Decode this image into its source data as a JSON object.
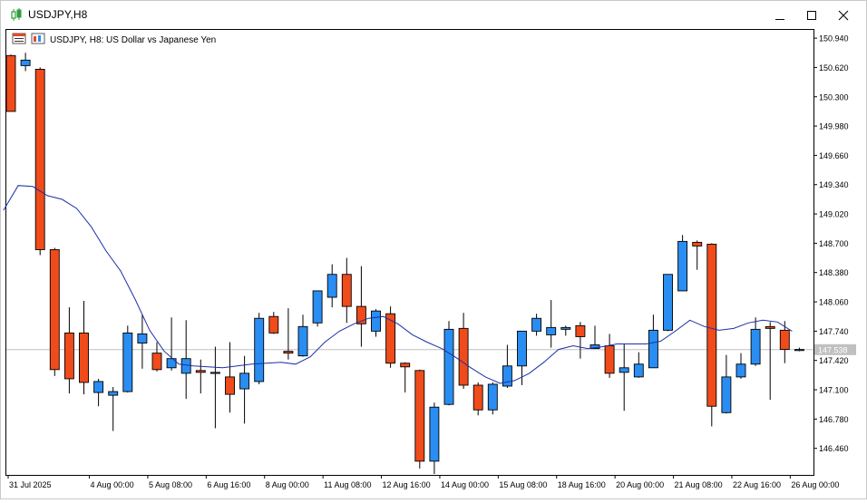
{
  "window": {
    "title": "USDJPY,H8",
    "icons": {
      "app": "chart-candles-icon",
      "minimize": "minimize-icon",
      "maximize": "maximize-icon",
      "close": "close-icon"
    }
  },
  "chart_header": {
    "text": "USDJPY, H8:  US Dollar vs Japanese Yen",
    "icons": [
      "chart-window-icon",
      "chart-type-icon"
    ]
  },
  "colors": {
    "bull": "#2a8df2",
    "bear": "#ef4b1b",
    "ma": "#1c2fa6",
    "price_line": "#c0c0c0",
    "price_tag_bg": "#c0c0c0"
  },
  "current_price": {
    "label": "147.538",
    "value": 147.538
  },
  "chart_data": {
    "type": "candlestick",
    "symbol": "USDJPY",
    "timeframe": "H8",
    "title": "USDJPY, H8:  US Dollar vs Japanese Yen",
    "ylim": [
      146.17,
      151.03
    ],
    "y_ticks": [
      "150.940",
      "150.620",
      "150.300",
      "149.980",
      "149.660",
      "149.340",
      "149.020",
      "148.700",
      "148.380",
      "148.060",
      "147.740",
      "147.420",
      "147.100",
      "146.780",
      "146.460"
    ],
    "x_ticks": [
      {
        "label": "31 Jul 2025",
        "index": 0
      },
      {
        "label": "4 Aug 00:00",
        "index": 5.5
      },
      {
        "label": "5 Aug 08:00",
        "index": 9.5
      },
      {
        "label": "6 Aug 16:00",
        "index": 13.5
      },
      {
        "label": "8 Aug 00:00",
        "index": 17.5
      },
      {
        "label": "11 Aug 08:00",
        "index": 21.5
      },
      {
        "label": "12 Aug 16:00",
        "index": 25.5
      },
      {
        "label": "14 Aug 00:00",
        "index": 29.5
      },
      {
        "label": "15 Aug 08:00",
        "index": 33.5
      },
      {
        "label": "18 Aug 16:00",
        "index": 37.5
      },
      {
        "label": "20 Aug 00:00",
        "index": 41.5
      },
      {
        "label": "21 Aug 08:00",
        "index": 45.5
      },
      {
        "label": "22 Aug 16:00",
        "index": 49.5
      },
      {
        "label": "26 Aug 00:00",
        "index": 53.5
      }
    ],
    "candles": [
      [
        150.75,
        150.76,
        150.14,
        150.14
      ],
      [
        150.64,
        150.78,
        150.58,
        150.7
      ],
      [
        150.6,
        150.62,
        148.57,
        148.63
      ],
      [
        148.63,
        148.65,
        147.25,
        147.32
      ],
      [
        147.72,
        148.0,
        147.06,
        147.22
      ],
      [
        147.72,
        148.07,
        147.05,
        147.18
      ],
      [
        147.07,
        147.22,
        146.92,
        147.19
      ],
      [
        147.04,
        147.13,
        146.65,
        147.08
      ],
      [
        147.08,
        147.8,
        147.07,
        147.72
      ],
      [
        147.61,
        147.92,
        147.33,
        147.71
      ],
      [
        147.5,
        147.62,
        147.3,
        147.32
      ],
      [
        147.34,
        147.89,
        147.31,
        147.44
      ],
      [
        147.28,
        147.86,
        147.0,
        147.44
      ],
      [
        147.31,
        147.43,
        147.06,
        147.29
      ],
      [
        147.28,
        147.57,
        146.68,
        147.29
      ],
      [
        147.24,
        147.62,
        146.85,
        147.05
      ],
      [
        147.11,
        147.47,
        146.73,
        147.28
      ],
      [
        147.19,
        147.94,
        147.16,
        147.88
      ],
      [
        147.9,
        147.95,
        147.71,
        147.72
      ],
      [
        147.52,
        147.99,
        147.43,
        147.5
      ],
      [
        147.47,
        147.92,
        147.46,
        147.79
      ],
      [
        147.83,
        148.16,
        147.79,
        148.18
      ],
      [
        148.11,
        148.47,
        148.0,
        148.36
      ],
      [
        148.36,
        148.54,
        147.83,
        148.01
      ],
      [
        148.01,
        148.45,
        147.57,
        147.82
      ],
      [
        147.74,
        147.98,
        147.68,
        147.96
      ],
      [
        147.93,
        148.01,
        147.34,
        147.39
      ],
      [
        147.39,
        147.4,
        147.07,
        147.35
      ],
      [
        147.31,
        147.32,
        146.24,
        146.32
      ],
      [
        146.32,
        146.96,
        146.18,
        146.91
      ],
      [
        146.94,
        147.85,
        146.93,
        147.76
      ],
      [
        147.77,
        147.94,
        147.11,
        147.15
      ],
      [
        147.15,
        147.18,
        146.82,
        146.88
      ],
      [
        146.88,
        147.18,
        146.83,
        147.16
      ],
      [
        147.14,
        147.59,
        147.12,
        147.36
      ],
      [
        147.36,
        147.74,
        147.15,
        147.74
      ],
      [
        147.74,
        147.93,
        147.69,
        147.88
      ],
      [
        147.7,
        148.08,
        147.56,
        147.78
      ],
      [
        147.76,
        147.8,
        147.69,
        147.78
      ],
      [
        147.8,
        147.84,
        147.44,
        147.68
      ],
      [
        147.55,
        147.8,
        147.55,
        147.59
      ],
      [
        147.58,
        147.71,
        147.23,
        147.28
      ],
      [
        147.29,
        147.6,
        146.87,
        147.34
      ],
      [
        147.24,
        147.51,
        147.23,
        147.38
      ],
      [
        147.34,
        147.92,
        147.34,
        147.75
      ],
      [
        147.75,
        148.33,
        147.74,
        148.36
      ],
      [
        148.18,
        148.79,
        148.18,
        148.72
      ],
      [
        148.71,
        148.73,
        148.41,
        148.67
      ],
      [
        148.69,
        148.7,
        146.7,
        146.92
      ],
      [
        146.85,
        147.48,
        146.84,
        147.24
      ],
      [
        147.24,
        147.5,
        147.22,
        147.38
      ],
      [
        147.38,
        147.89,
        147.36,
        147.76
      ],
      [
        147.79,
        147.84,
        146.99,
        147.77
      ],
      [
        147.75,
        147.85,
        147.39,
        147.54
      ],
      [
        147.53,
        147.56,
        147.52,
        147.54
      ]
    ],
    "ma_line": [
      [
        -0.5,
        149.06
      ],
      [
        0.5,
        149.33
      ],
      [
        1.5,
        149.32
      ],
      [
        2.5,
        149.22
      ],
      [
        3.5,
        149.18
      ],
      [
        4.5,
        149.08
      ],
      [
        5.5,
        148.88
      ],
      [
        6.5,
        148.62
      ],
      [
        7.5,
        148.4
      ],
      [
        8.5,
        148.09
      ],
      [
        9.5,
        147.75
      ],
      [
        10.5,
        147.52
      ],
      [
        11.5,
        147.38
      ],
      [
        12.5,
        147.36
      ],
      [
        13.5,
        147.35
      ],
      [
        14.5,
        147.34
      ],
      [
        15.5,
        147.36
      ],
      [
        16.5,
        147.38
      ],
      [
        17.5,
        147.39
      ],
      [
        18.5,
        147.4
      ],
      [
        19.5,
        147.38
      ],
      [
        20.5,
        147.46
      ],
      [
        21.5,
        147.62
      ],
      [
        22.5,
        147.74
      ],
      [
        23.5,
        147.82
      ],
      [
        24.5,
        147.88
      ],
      [
        25.5,
        147.9
      ],
      [
        26.5,
        147.82
      ],
      [
        27.5,
        147.7
      ],
      [
        28.5,
        147.62
      ],
      [
        29.5,
        147.55
      ],
      [
        30.5,
        147.45
      ],
      [
        31.5,
        147.34
      ],
      [
        32.5,
        147.24
      ],
      [
        33.5,
        147.17
      ],
      [
        34.5,
        147.2
      ],
      [
        35.5,
        147.28
      ],
      [
        36.5,
        147.4
      ],
      [
        37.5,
        147.54
      ],
      [
        38.5,
        147.58
      ],
      [
        39.5,
        147.55
      ],
      [
        40.5,
        147.57
      ],
      [
        41.5,
        147.6
      ],
      [
        42.5,
        147.6
      ],
      [
        43.5,
        147.6
      ],
      [
        44.5,
        147.63
      ],
      [
        45.5,
        147.74
      ],
      [
        46.5,
        147.86
      ],
      [
        47.5,
        147.79
      ],
      [
        48.5,
        147.75
      ],
      [
        49.5,
        147.77
      ],
      [
        50.5,
        147.83
      ],
      [
        51.5,
        147.86
      ],
      [
        52.5,
        147.84
      ],
      [
        53.5,
        147.74
      ]
    ]
  }
}
